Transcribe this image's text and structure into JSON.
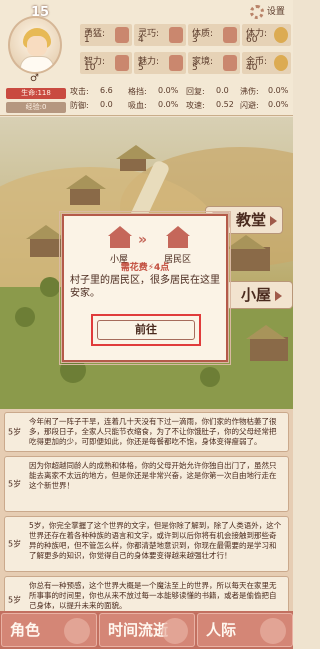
{
  "player": {
    "level": "15",
    "gender": "♂",
    "hp_label": "生命:118",
    "xp_label": "经验:0"
  },
  "settings_label": "设置",
  "attributes": [
    {
      "label": "勇猛:",
      "value": "1",
      "icon": "fist-icon"
    },
    {
      "label": "灵巧:",
      "value": "4",
      "icon": "glove-icon"
    },
    {
      "label": "体质:",
      "value": "3",
      "icon": "arm-icon"
    },
    {
      "label": "体力:",
      "value": "60",
      "icon": "lightning-icon"
    },
    {
      "label": "智力:",
      "value": "10",
      "icon": "brain-icon"
    },
    {
      "label": "魅力:",
      "value": "5",
      "icon": "shirt-icon"
    },
    {
      "label": "家境:",
      "value": "5",
      "icon": "house-icon"
    },
    {
      "label": "金币:",
      "value": "40",
      "icon": "coin-icon"
    }
  ],
  "combat": [
    [
      {
        "label": "攻击:",
        "value": "6.6"
      },
      {
        "label": "格挡:",
        "value": "0.0%"
      },
      {
        "label": "回复:",
        "value": "0.0"
      },
      {
        "label": "沸伤:",
        "value": "0.0%"
      }
    ],
    [
      {
        "label": "防御:",
        "value": "0.0"
      },
      {
        "label": "吸血:",
        "value": "0.0%"
      },
      {
        "label": "攻速:",
        "value": "0.52"
      },
      {
        "label": "闪避:",
        "value": "0.0%"
      }
    ]
  ],
  "map_places": {
    "church": "教堂",
    "hut": "小屋"
  },
  "popup": {
    "from": "小屋",
    "to": "居民区",
    "cost": "需花费⚡4点",
    "description": "村子里的居民区，很多居民在这里安家。",
    "go_button": "前往"
  },
  "log": [
    {
      "age": "5岁",
      "text": "今年闹了一阵子干旱，连着几十天没有下过一滴雨，你们家的作物枯萎了很多，那段日子，全家人只能节衣缩食，为了不让你饿肚子，你的父母经常把吃得更加的少，可即便如此，你还是每餐都吃不饱，身体变得瘦弱了。"
    },
    {
      "age": "5岁",
      "text": "因为你超越同龄人的成熟和体格，你的父母开始允许你独自出门了，虽然只能去离家不太远的地方，但是你还是非常兴奋，这是你第一次自由地行走在这个新世界！"
    },
    {
      "age": "5岁",
      "text": "5岁，你完全掌握了这个世界的文字，但是你除了解到，除了人类语外，这个世界还存在着各种种族的语言和文字，或许到以后你将有机会接触到那些奇异的种族吧，但不管怎么样，你都清楚地意识到，你现在最需要的是学习和了解更多的知识，你觉得自己的身体要变得越来越强壮才行！"
    },
    {
      "age": "5岁",
      "text": "你总有一种预感，这个世界大概是一个魔法至上的世界，所以每天在家里无所事事的时间里，你也从来不放过每一本能够读懂的书籍，或者是偷偷把自己身体，以提升未来的面貌。"
    }
  ],
  "nav": [
    {
      "label": "角色",
      "icon": "character-icon"
    },
    {
      "label": "时间流逝",
      "icon": "hourglass-icon"
    },
    {
      "label": "人际",
      "icon": "people-icon"
    }
  ]
}
